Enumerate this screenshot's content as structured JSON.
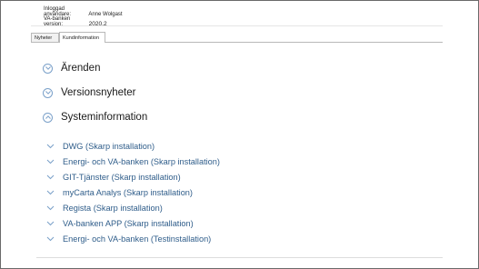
{
  "header": {
    "user_label": "Inloggad användare:",
    "user_value": "Anne Wolgast",
    "version_label": "VA-banken version:",
    "version_value": "2020.2"
  },
  "tabs": [
    {
      "label": "Nyheter",
      "active": false
    },
    {
      "label": "Kundinformation",
      "active": true
    }
  ],
  "sections": [
    {
      "title": "Ärenden",
      "expanded": false
    },
    {
      "title": "Versionsnyheter",
      "expanded": false
    },
    {
      "title": "Systeminformation",
      "expanded": true
    }
  ],
  "systeminfo_items": [
    "DWG (Skarp installation)",
    "Energi- och VA-banken (Skarp installation)",
    "GIT-Tjänster (Skarp installation)",
    "myCarta Analys (Skarp installation)",
    "Regista (Skarp installation)",
    "VA-banken APP (Skarp installation)",
    "Energi- och VA-banken (Testinstallation)"
  ],
  "colors": {
    "accent": "#7aa0c9",
    "link_text": "#2f5d8a"
  }
}
